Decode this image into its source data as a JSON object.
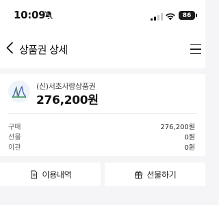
{
  "status_bar": {
    "time": "10:09",
    "battery": "86"
  },
  "nav": {
    "title": "상품권 상세"
  },
  "card": {
    "name": "(신)서초사랑상품권",
    "balance": "276,200원",
    "rows": [
      {
        "label": "구매",
        "value": "276,200원"
      },
      {
        "label": "선물",
        "value": "0원"
      },
      {
        "label": "이관",
        "value": "0원"
      }
    ]
  },
  "actions": {
    "history_label": "이용내역",
    "gift_label": "선물하기"
  }
}
